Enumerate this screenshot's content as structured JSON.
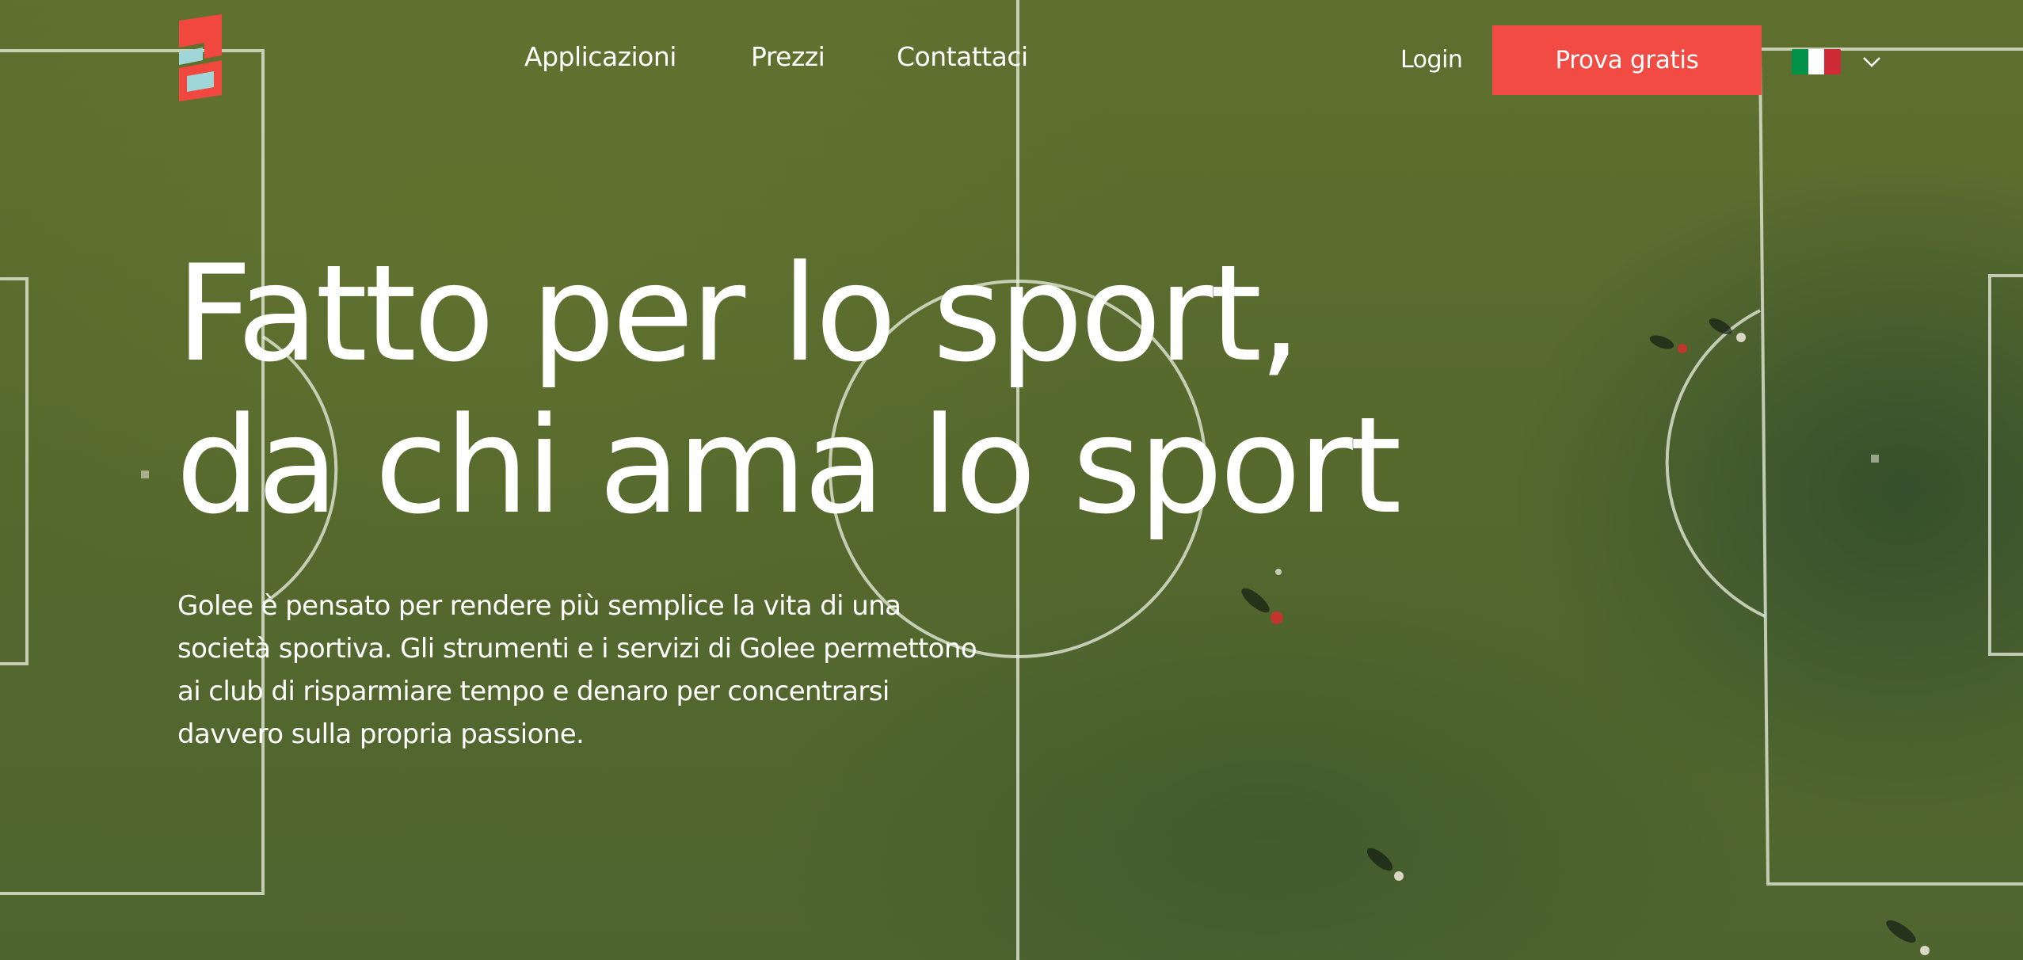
{
  "brand": {
    "logo_icon": "golee-logo-icon",
    "colors": {
      "accent": "#f24b43",
      "logo_red": "#f0473e",
      "logo_teal": "#9fd6d8",
      "field_green": "#5a6b2c"
    }
  },
  "nav": {
    "items": [
      {
        "label": "Applicazioni"
      },
      {
        "label": "Prezzi"
      },
      {
        "label": "Contattaci"
      }
    ],
    "login_label": "Login",
    "cta_label": "Prova gratis",
    "language": {
      "flag_icon": "italy-flag-icon",
      "flag_colors": [
        "#009246",
        "#ffffff",
        "#ce2b37"
      ],
      "dropdown_icon": "chevron-down-icon"
    }
  },
  "hero": {
    "title_line1": "Fatto per lo sport,",
    "title_line2": "da chi ama lo sport",
    "description": "Golee è pensato per rendere più semplice la vita di una società sportiva. Gli strumenti e i servizi di Golee permettono ai club di risparmiare tempo e denaro per concentrarsi davvero sulla propria passione."
  }
}
